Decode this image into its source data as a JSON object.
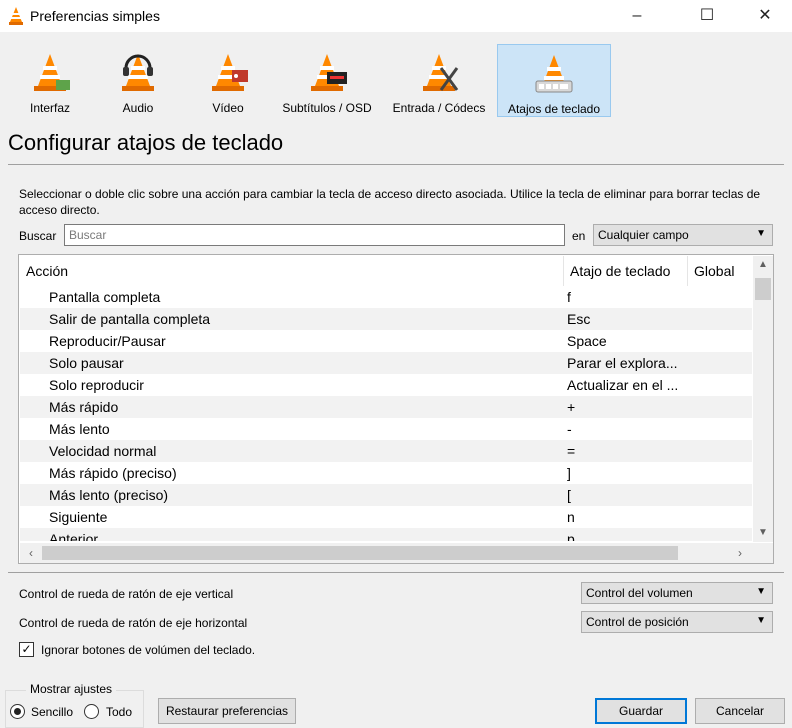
{
  "window": {
    "title": "Preferencias simples",
    "min": "–",
    "max": "☐",
    "close": "✕"
  },
  "toolbar": [
    {
      "label": "Interfaz",
      "icon": "interface-icon"
    },
    {
      "label": "Audio",
      "icon": "audio-icon"
    },
    {
      "label": "Vídeo",
      "icon": "video-icon"
    },
    {
      "label": "Subtítulos / OSD",
      "icon": "subtitles-icon"
    },
    {
      "label": "Entrada / Códecs",
      "icon": "input-codecs-icon"
    },
    {
      "label": "Atajos de teclado",
      "icon": "hotkeys-icon",
      "active": true
    }
  ],
  "heading": "Configurar atajos de teclado",
  "description": "Seleccionar o doble clic sobre una acción para cambiar la tecla de acceso directo asociada. Utilice la tecla de eliminar para borrar teclas de acceso directo.",
  "search": {
    "label": "Buscar",
    "placeholder": "Buscar",
    "in_label": "en",
    "field": "Cualquier campo"
  },
  "table": {
    "headers": {
      "action": "Acción",
      "hotkey": "Atajo de teclado",
      "global": "Global"
    },
    "rows": [
      {
        "action": "Pantalla completa",
        "hotkey": "f"
      },
      {
        "action": "Salir de pantalla completa",
        "hotkey": "Esc"
      },
      {
        "action": "Reproducir/Pausar",
        "hotkey": "Space"
      },
      {
        "action": "Solo pausar",
        "hotkey": "Parar el explora..."
      },
      {
        "action": "Solo reproducir",
        "hotkey": "Actualizar en el ..."
      },
      {
        "action": "Más rápido",
        "hotkey": "+"
      },
      {
        "action": "Más lento",
        "hotkey": "-"
      },
      {
        "action": "Velocidad normal",
        "hotkey": "="
      },
      {
        "action": "Más rápido (preciso)",
        "hotkey": "]"
      },
      {
        "action": "Más lento (preciso)",
        "hotkey": "["
      },
      {
        "action": "Siguiente",
        "hotkey": "n"
      },
      {
        "action": "Anterior",
        "hotkey": "p"
      }
    ]
  },
  "wheel": {
    "vertical_label": "Control de rueda de ratón de eje vertical",
    "vertical_value": "Control del volumen",
    "horizontal_label": "Control de rueda de ratón de eje horizontal",
    "horizontal_value": "Control de posición"
  },
  "ignore_volume": {
    "label": "Ignorar botones de volúmen del teclado.",
    "checked": true
  },
  "show_settings": {
    "title": "Mostrar ajustes",
    "simple": "Sencillo",
    "all": "Todo",
    "selected": "Sencillo"
  },
  "buttons": {
    "reset": "Restaurar preferencias",
    "save": "Guardar",
    "cancel": "Cancelar"
  }
}
